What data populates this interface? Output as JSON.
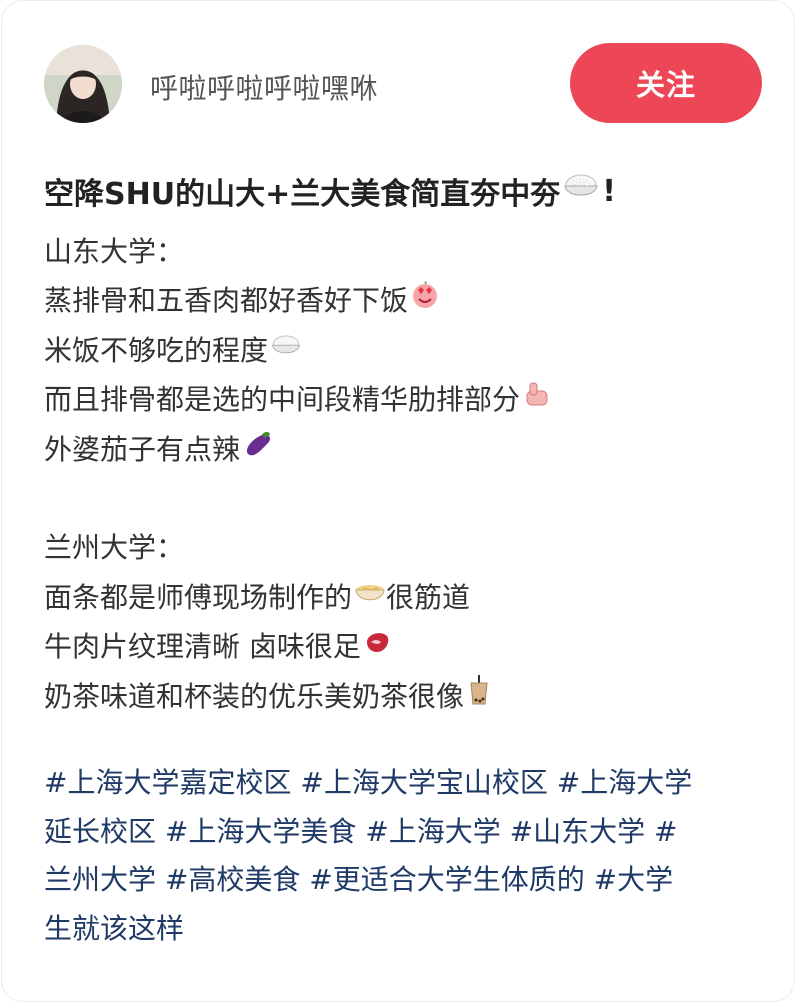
{
  "post": {
    "author": {
      "name": "呼啦呼啦呼啦嘿咻",
      "avatar_icon": "avatar-photo"
    },
    "follow_label": "关注",
    "title": "空降SHU的山大+兰大美食简直夯中夯",
    "title_end": "!",
    "content": [
      {
        "text": "山东大学：",
        "emoji": ""
      },
      {
        "text": "蒸排骨和五香肉都好香好下饭",
        "emoji": "heart-eyes-face-icon"
      },
      {
        "text": "米饭不够吃的程度",
        "emoji": "rice-bowl-icon"
      },
      {
        "text": "而且排骨都是选的中间段精华肋排部分",
        "emoji": "thumbs-up-icon"
      },
      {
        "text": "外婆茄子有点辣",
        "emoji": "eggplant-icon"
      },
      {
        "text": "",
        "emoji": ""
      },
      {
        "text": "兰州大学：",
        "emoji": ""
      },
      {
        "text": "面条都是师傅现场制作的",
        "emoji": "noodle-bowl-icon",
        "after": " 很筋道"
      },
      {
        "text": "牛肉片纹理清晰 卤味很足",
        "emoji": "meat-icon"
      },
      {
        "text": "奶茶味道和杯装的优乐美奶茶很像",
        "emoji": "bubble-tea-icon"
      }
    ],
    "hashtag_lines": [
      [
        "#上海大学嘉定校区",
        " ",
        "#上海大学宝山校区",
        " ",
        "#上海大学"
      ],
      [
        "延长校区",
        " ",
        "#上海大学美食",
        " ",
        "#上海大学",
        " ",
        "#山东大学",
        " ",
        "#"
      ],
      [
        "兰州大学",
        " ",
        "#高校美食",
        " ",
        "#更适合大学生体质的",
        " ",
        "#大学"
      ],
      [
        "生就该这样"
      ]
    ]
  },
  "colors": {
    "accent": "#ec4657",
    "hashtag": "#1f3a66",
    "text": "#333333"
  }
}
